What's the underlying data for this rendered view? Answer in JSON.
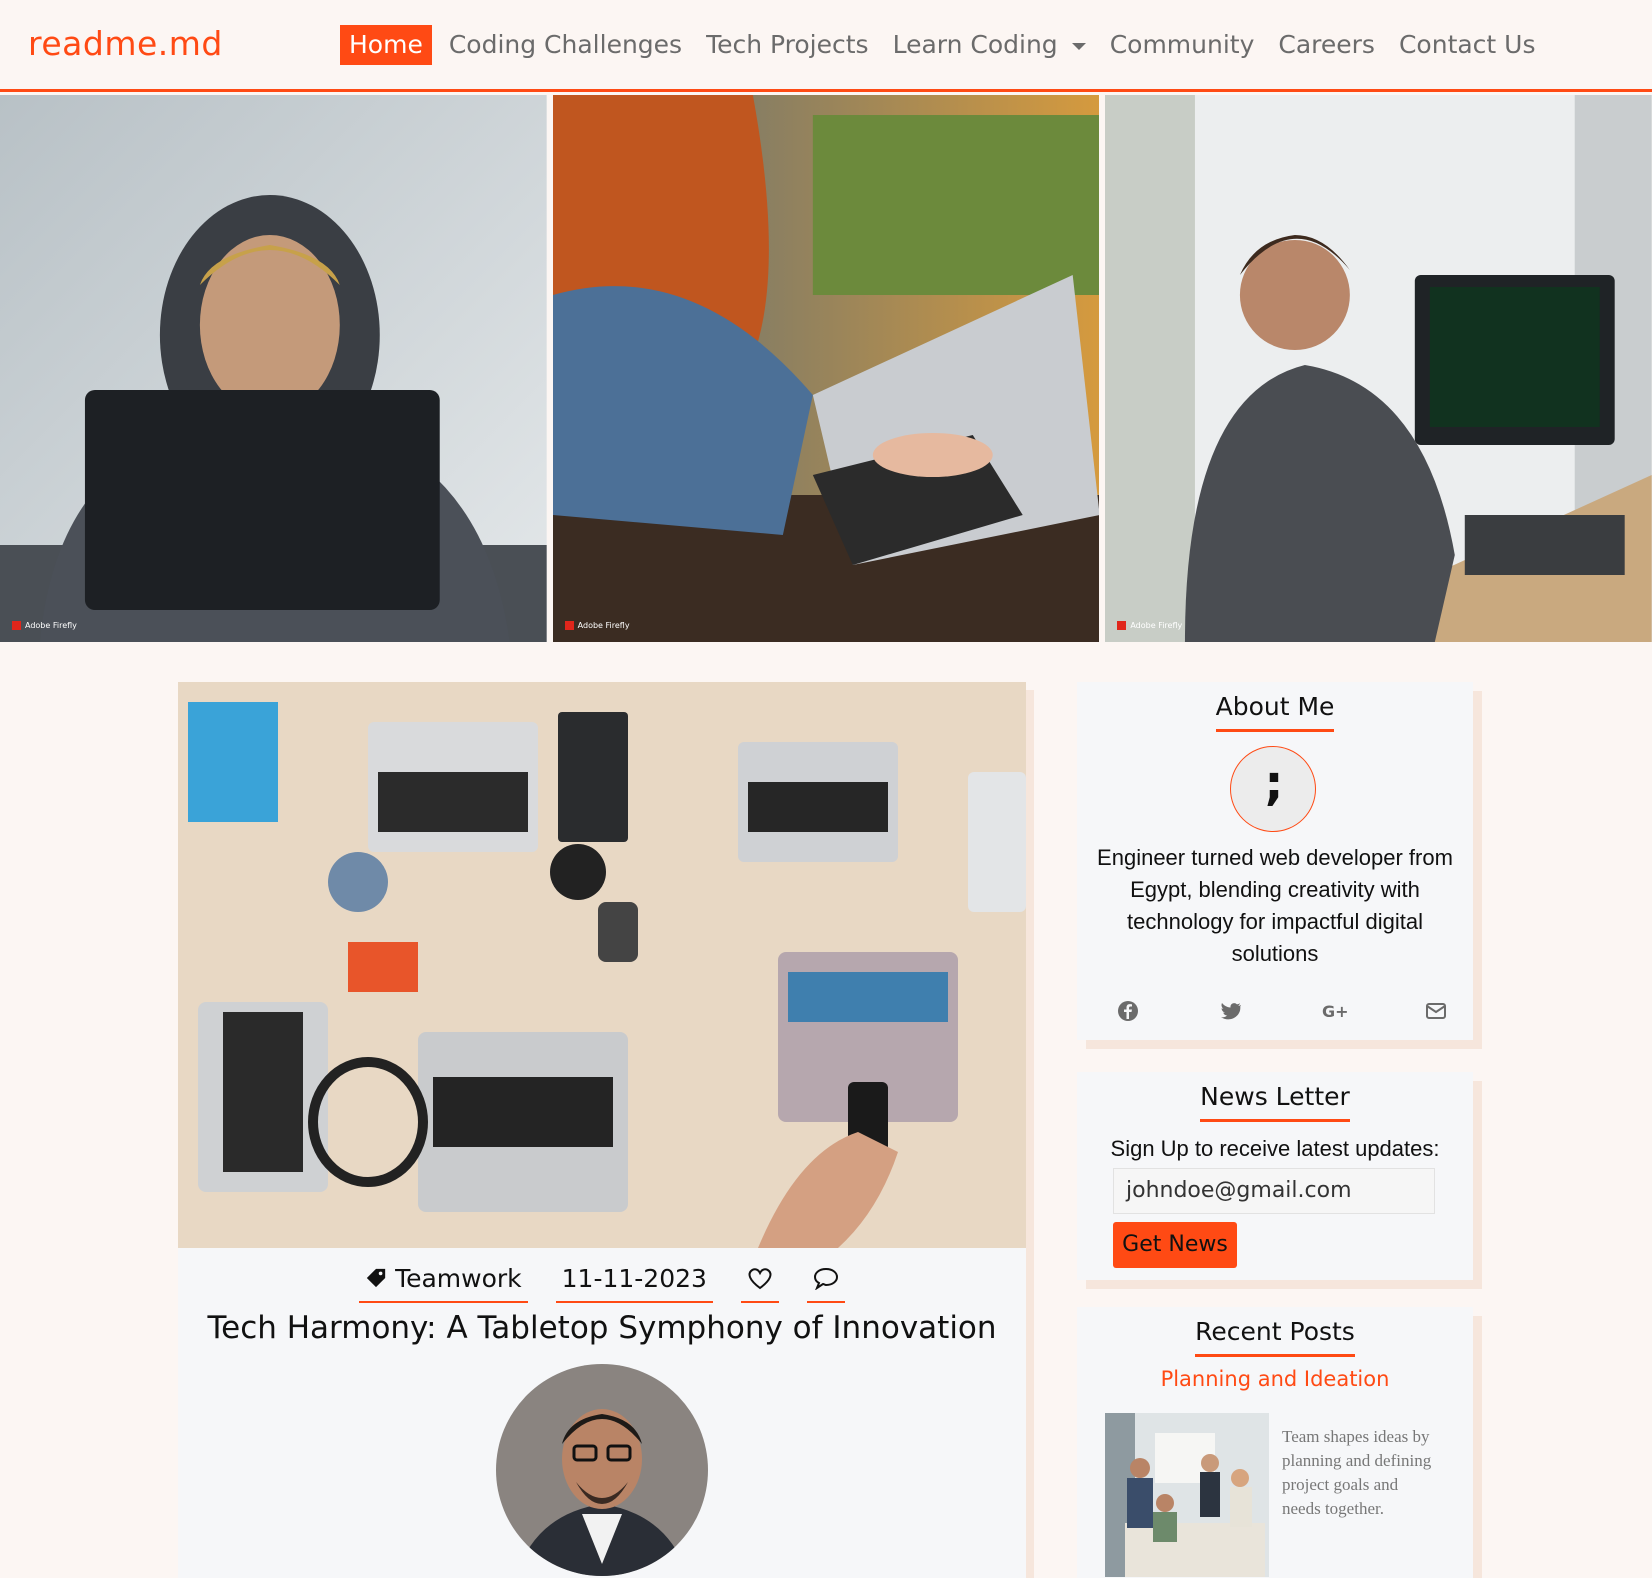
{
  "brand": "readme.md",
  "nav": {
    "home": "Home",
    "coding_challenges": "Coding Challenges",
    "tech_projects": "Tech Projects",
    "learn_coding": "Learn Coding",
    "community": "Community",
    "careers": "Careers",
    "contact": "Contact Us"
  },
  "hero": {
    "watermark": "Adobe Firefly"
  },
  "post": {
    "category": "Teamwork",
    "date": "11-11-2023",
    "title": "Tech Harmony: A Tabletop Symphony of Innovation"
  },
  "about": {
    "title": "About Me",
    "avatar_glyph": ";",
    "bio": "Engineer turned web developer from Egypt, blending creativity with technology for impactful digital solutions",
    "socials": [
      "facebook-icon",
      "twitter-icon",
      "google-plus-icon",
      "envelope-icon"
    ]
  },
  "newsletter": {
    "title": "News Letter",
    "subtitle": "Sign Up to receive latest updates:",
    "email_value": "johndoe@gmail.com",
    "button": "Get News"
  },
  "recent": {
    "title": "Recent Posts",
    "post_title": "Planning and Ideation",
    "post_text": "Team shapes ideas by planning and defining project goals and needs together."
  },
  "colors": {
    "accent": "#ff4a14",
    "background": "#fcf6f3",
    "card": "#f6f7f9",
    "card_shadow": "#f6e6dc"
  }
}
